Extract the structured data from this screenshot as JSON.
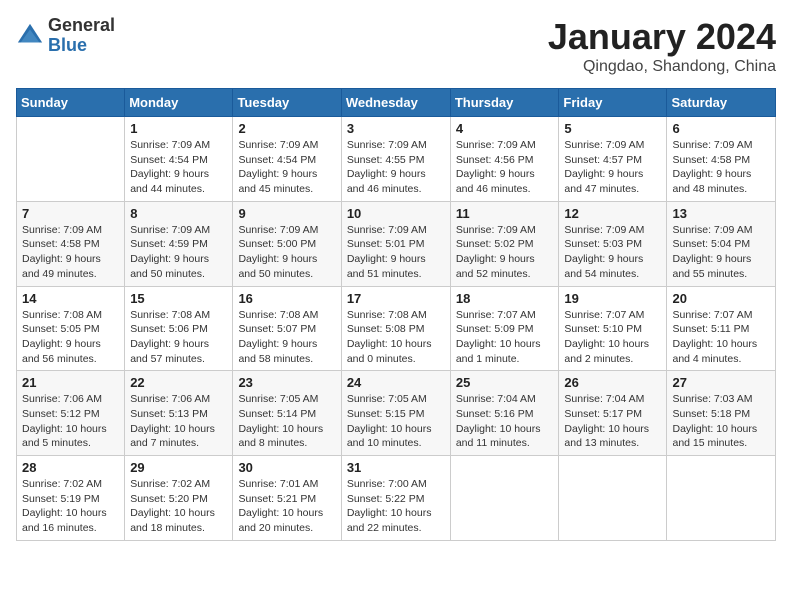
{
  "header": {
    "logo_general": "General",
    "logo_blue": "Blue",
    "title": "January 2024",
    "location": "Qingdao, Shandong, China"
  },
  "weekdays": [
    "Sunday",
    "Monday",
    "Tuesday",
    "Wednesday",
    "Thursday",
    "Friday",
    "Saturday"
  ],
  "weeks": [
    [
      {
        "day": "",
        "sunrise": "",
        "sunset": "",
        "daylight": ""
      },
      {
        "day": "1",
        "sunrise": "Sunrise: 7:09 AM",
        "sunset": "Sunset: 4:54 PM",
        "daylight": "Daylight: 9 hours and 44 minutes."
      },
      {
        "day": "2",
        "sunrise": "Sunrise: 7:09 AM",
        "sunset": "Sunset: 4:54 PM",
        "daylight": "Daylight: 9 hours and 45 minutes."
      },
      {
        "day": "3",
        "sunrise": "Sunrise: 7:09 AM",
        "sunset": "Sunset: 4:55 PM",
        "daylight": "Daylight: 9 hours and 46 minutes."
      },
      {
        "day": "4",
        "sunrise": "Sunrise: 7:09 AM",
        "sunset": "Sunset: 4:56 PM",
        "daylight": "Daylight: 9 hours and 46 minutes."
      },
      {
        "day": "5",
        "sunrise": "Sunrise: 7:09 AM",
        "sunset": "Sunset: 4:57 PM",
        "daylight": "Daylight: 9 hours and 47 minutes."
      },
      {
        "day": "6",
        "sunrise": "Sunrise: 7:09 AM",
        "sunset": "Sunset: 4:58 PM",
        "daylight": "Daylight: 9 hours and 48 minutes."
      }
    ],
    [
      {
        "day": "7",
        "sunrise": "Sunrise: 7:09 AM",
        "sunset": "Sunset: 4:58 PM",
        "daylight": "Daylight: 9 hours and 49 minutes."
      },
      {
        "day": "8",
        "sunrise": "Sunrise: 7:09 AM",
        "sunset": "Sunset: 4:59 PM",
        "daylight": "Daylight: 9 hours and 50 minutes."
      },
      {
        "day": "9",
        "sunrise": "Sunrise: 7:09 AM",
        "sunset": "Sunset: 5:00 PM",
        "daylight": "Daylight: 9 hours and 50 minutes."
      },
      {
        "day": "10",
        "sunrise": "Sunrise: 7:09 AM",
        "sunset": "Sunset: 5:01 PM",
        "daylight": "Daylight: 9 hours and 51 minutes."
      },
      {
        "day": "11",
        "sunrise": "Sunrise: 7:09 AM",
        "sunset": "Sunset: 5:02 PM",
        "daylight": "Daylight: 9 hours and 52 minutes."
      },
      {
        "day": "12",
        "sunrise": "Sunrise: 7:09 AM",
        "sunset": "Sunset: 5:03 PM",
        "daylight": "Daylight: 9 hours and 54 minutes."
      },
      {
        "day": "13",
        "sunrise": "Sunrise: 7:09 AM",
        "sunset": "Sunset: 5:04 PM",
        "daylight": "Daylight: 9 hours and 55 minutes."
      }
    ],
    [
      {
        "day": "14",
        "sunrise": "Sunrise: 7:08 AM",
        "sunset": "Sunset: 5:05 PM",
        "daylight": "Daylight: 9 hours and 56 minutes."
      },
      {
        "day": "15",
        "sunrise": "Sunrise: 7:08 AM",
        "sunset": "Sunset: 5:06 PM",
        "daylight": "Daylight: 9 hours and 57 minutes."
      },
      {
        "day": "16",
        "sunrise": "Sunrise: 7:08 AM",
        "sunset": "Sunset: 5:07 PM",
        "daylight": "Daylight: 9 hours and 58 minutes."
      },
      {
        "day": "17",
        "sunrise": "Sunrise: 7:08 AM",
        "sunset": "Sunset: 5:08 PM",
        "daylight": "Daylight: 10 hours and 0 minutes."
      },
      {
        "day": "18",
        "sunrise": "Sunrise: 7:07 AM",
        "sunset": "Sunset: 5:09 PM",
        "daylight": "Daylight: 10 hours and 1 minute."
      },
      {
        "day": "19",
        "sunrise": "Sunrise: 7:07 AM",
        "sunset": "Sunset: 5:10 PM",
        "daylight": "Daylight: 10 hours and 2 minutes."
      },
      {
        "day": "20",
        "sunrise": "Sunrise: 7:07 AM",
        "sunset": "Sunset: 5:11 PM",
        "daylight": "Daylight: 10 hours and 4 minutes."
      }
    ],
    [
      {
        "day": "21",
        "sunrise": "Sunrise: 7:06 AM",
        "sunset": "Sunset: 5:12 PM",
        "daylight": "Daylight: 10 hours and 5 minutes."
      },
      {
        "day": "22",
        "sunrise": "Sunrise: 7:06 AM",
        "sunset": "Sunset: 5:13 PM",
        "daylight": "Daylight: 10 hours and 7 minutes."
      },
      {
        "day": "23",
        "sunrise": "Sunrise: 7:05 AM",
        "sunset": "Sunset: 5:14 PM",
        "daylight": "Daylight: 10 hours and 8 minutes."
      },
      {
        "day": "24",
        "sunrise": "Sunrise: 7:05 AM",
        "sunset": "Sunset: 5:15 PM",
        "daylight": "Daylight: 10 hours and 10 minutes."
      },
      {
        "day": "25",
        "sunrise": "Sunrise: 7:04 AM",
        "sunset": "Sunset: 5:16 PM",
        "daylight": "Daylight: 10 hours and 11 minutes."
      },
      {
        "day": "26",
        "sunrise": "Sunrise: 7:04 AM",
        "sunset": "Sunset: 5:17 PM",
        "daylight": "Daylight: 10 hours and 13 minutes."
      },
      {
        "day": "27",
        "sunrise": "Sunrise: 7:03 AM",
        "sunset": "Sunset: 5:18 PM",
        "daylight": "Daylight: 10 hours and 15 minutes."
      }
    ],
    [
      {
        "day": "28",
        "sunrise": "Sunrise: 7:02 AM",
        "sunset": "Sunset: 5:19 PM",
        "daylight": "Daylight: 10 hours and 16 minutes."
      },
      {
        "day": "29",
        "sunrise": "Sunrise: 7:02 AM",
        "sunset": "Sunset: 5:20 PM",
        "daylight": "Daylight: 10 hours and 18 minutes."
      },
      {
        "day": "30",
        "sunrise": "Sunrise: 7:01 AM",
        "sunset": "Sunset: 5:21 PM",
        "daylight": "Daylight: 10 hours and 20 minutes."
      },
      {
        "day": "31",
        "sunrise": "Sunrise: 7:00 AM",
        "sunset": "Sunset: 5:22 PM",
        "daylight": "Daylight: 10 hours and 22 minutes."
      },
      {
        "day": "",
        "sunrise": "",
        "sunset": "",
        "daylight": ""
      },
      {
        "day": "",
        "sunrise": "",
        "sunset": "",
        "daylight": ""
      },
      {
        "day": "",
        "sunrise": "",
        "sunset": "",
        "daylight": ""
      }
    ]
  ]
}
